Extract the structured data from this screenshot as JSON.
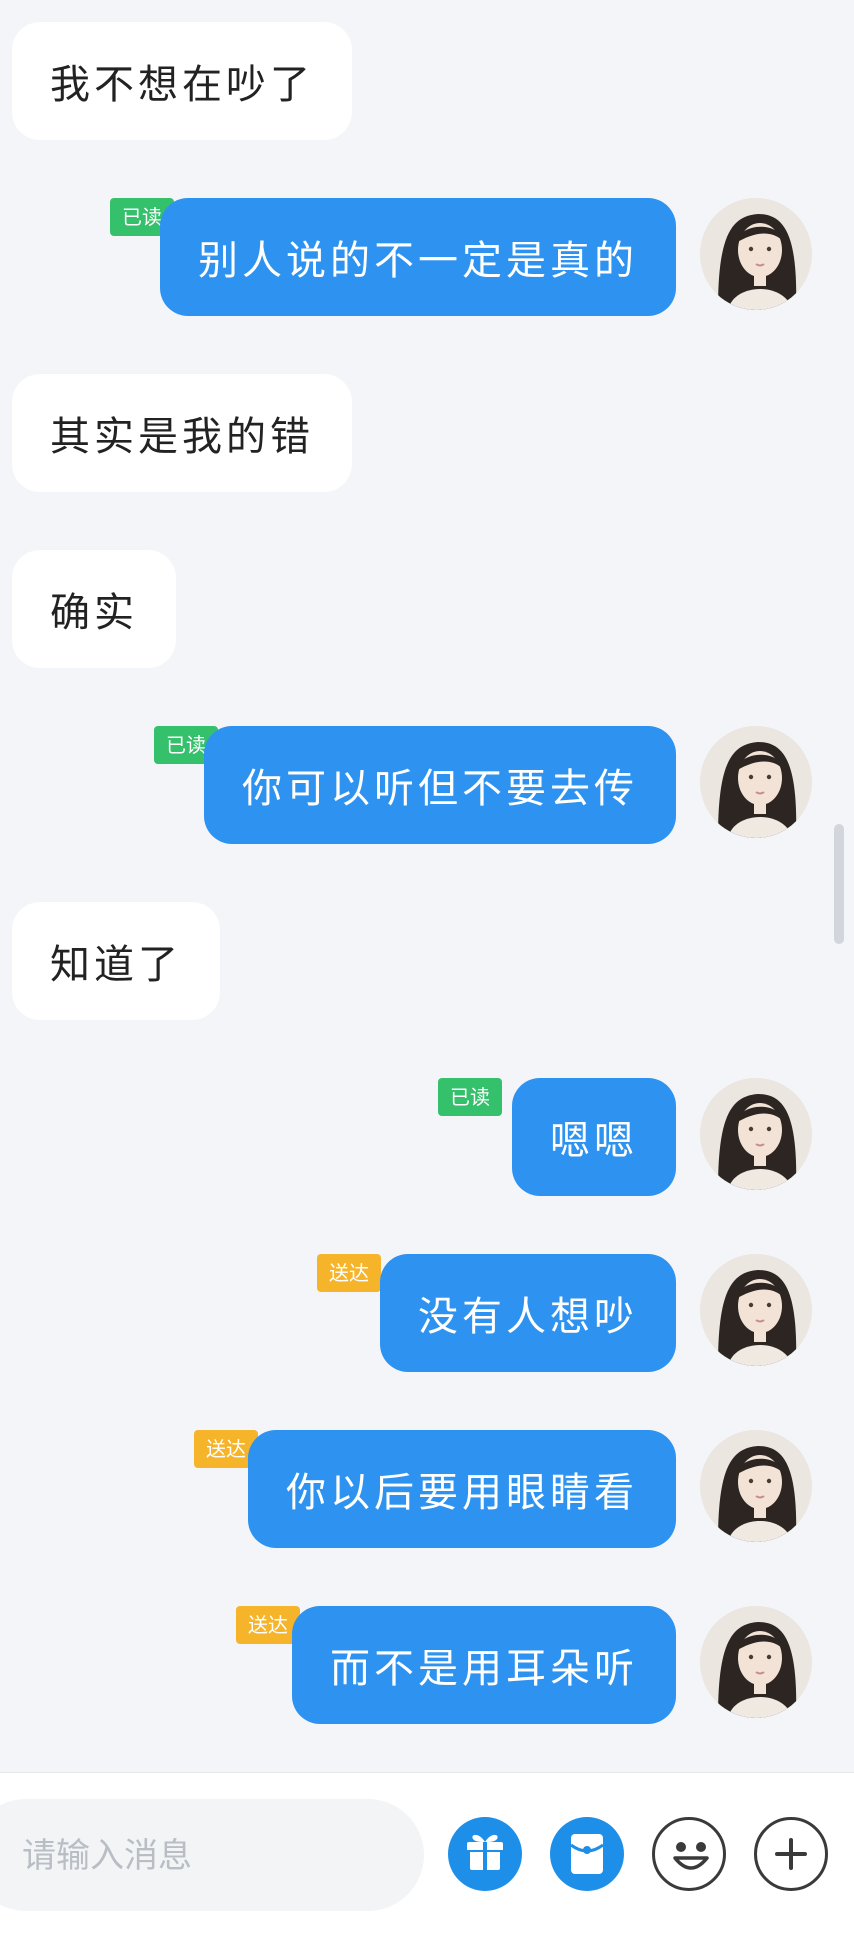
{
  "colors": {
    "background": "#f3f5f8",
    "incoming_bubble": "#ffffff",
    "outgoing_bubble": "#2e93f0",
    "read_status": "#35c06b",
    "delivered_status": "#f6b42b",
    "tool_blue": "#1d8fe8"
  },
  "messages": [
    {
      "direction": "in",
      "text": "我不想在吵了"
    },
    {
      "direction": "out",
      "text": "别人说的不一定是真的",
      "status": "已读",
      "avatar_icon": "user-avatar-icon"
    },
    {
      "direction": "in",
      "text": "其实是我的错"
    },
    {
      "direction": "in",
      "text": "确实"
    },
    {
      "direction": "out",
      "text": "你可以听但不要去传",
      "status": "已读",
      "avatar_icon": "user-avatar-icon"
    },
    {
      "direction": "in",
      "text": "知道了"
    },
    {
      "direction": "out",
      "text": "嗯嗯",
      "status": "已读",
      "avatar_icon": "user-avatar-icon"
    },
    {
      "direction": "out",
      "text": "没有人想吵",
      "status": "送达",
      "avatar_icon": "user-avatar-icon"
    },
    {
      "direction": "out",
      "text": "你以后要用眼睛看",
      "status": "送达",
      "avatar_icon": "user-avatar-icon"
    },
    {
      "direction": "out",
      "text": "而不是用耳朵听",
      "status": "送达",
      "avatar_icon": "user-avatar-icon"
    }
  ],
  "composer": {
    "placeholder": "请输入消息",
    "value": "",
    "tools": [
      {
        "icon": "gift-icon"
      },
      {
        "icon": "red-packet-icon"
      },
      {
        "icon": "emoji-icon"
      },
      {
        "icon": "plus-icon"
      }
    ]
  }
}
